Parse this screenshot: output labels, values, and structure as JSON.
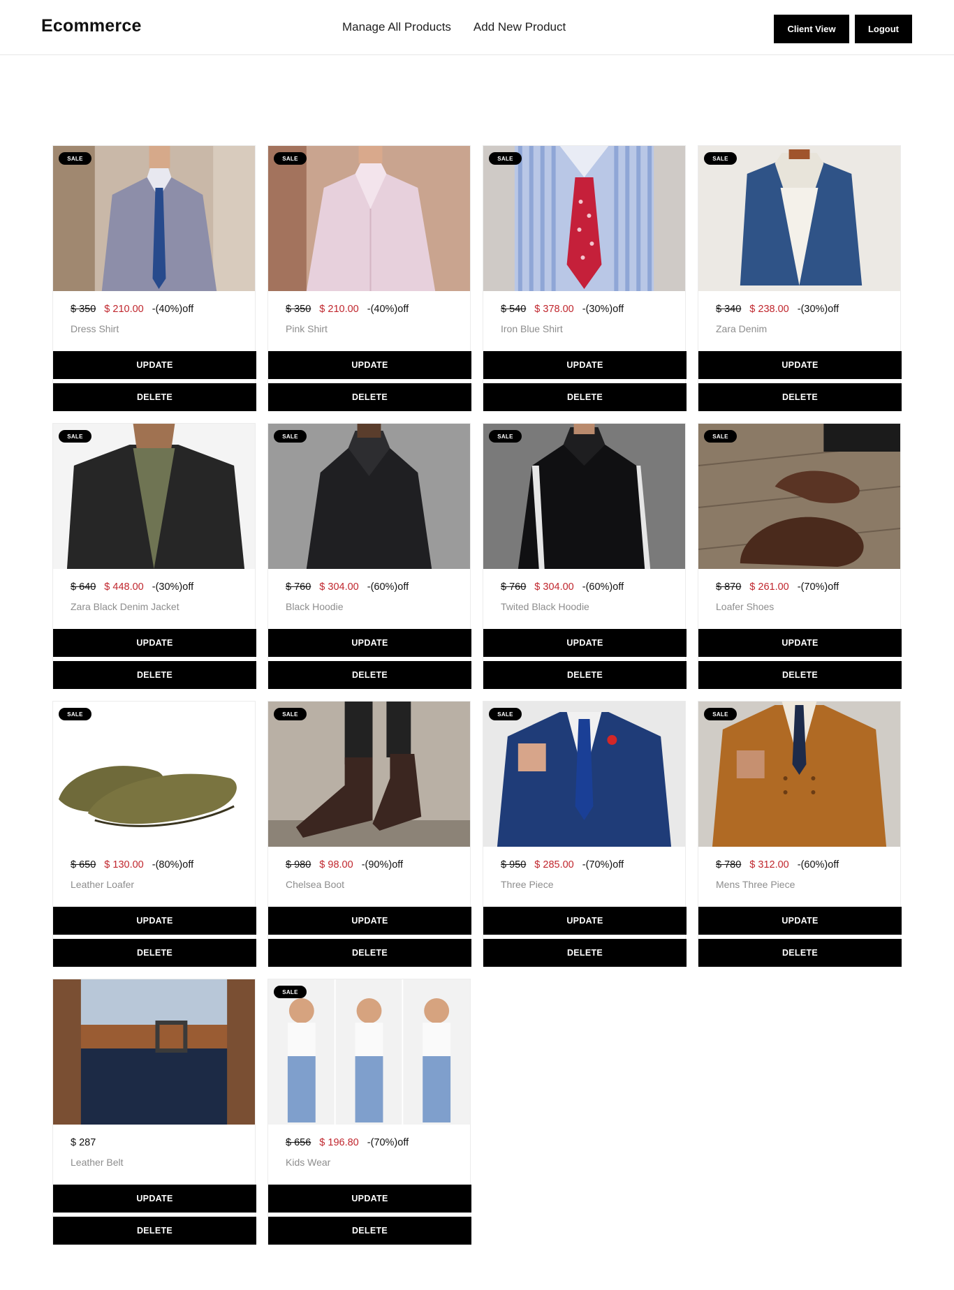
{
  "header": {
    "brand": "Ecommerce",
    "nav_links": [
      "Manage All Products",
      "Add New Product"
    ],
    "client_view_label": "Client View",
    "logout_label": "Logout"
  },
  "colors": {
    "accent": "#000000",
    "sale_price": "#c0262d",
    "muted_text": "#8d8d8d"
  },
  "labels": {
    "sale_badge": "SALE",
    "update": "UPDATE",
    "delete": "DELETE"
  },
  "products": [
    {
      "name": "Dress Shirt",
      "old_price": "$ 350",
      "new_price": "$ 210.00",
      "discount": "-(40%)off",
      "sale": true,
      "image": "shirt-purple-tie-photo"
    },
    {
      "name": "Pink Shirt",
      "old_price": "$ 350",
      "new_price": "$ 210.00",
      "discount": "-(40%)off",
      "sale": true,
      "image": "pink-shirt-photo"
    },
    {
      "name": "Iron Blue Shirt",
      "old_price": "$ 540",
      "new_price": "$ 378.00",
      "discount": "-(30%)off",
      "sale": true,
      "image": "striped-shirt-red-tie-photo"
    },
    {
      "name": "Zara Denim",
      "old_price": "$ 340",
      "new_price": "$ 238.00",
      "discount": "-(30%)off",
      "sale": true,
      "image": "denim-jacket-photo"
    },
    {
      "name": "Zara Black Denim Jacket",
      "old_price": "$ 640",
      "new_price": "$ 448.00",
      "discount": "-(30%)off",
      "sale": true,
      "image": "black-denim-jacket-photo"
    },
    {
      "name": "Black Hoodie",
      "old_price": "$ 760",
      "new_price": "$ 304.00",
      "discount": "-(60%)off",
      "sale": true,
      "image": "black-hoodie-photo"
    },
    {
      "name": "Twited Black Hoodie",
      "old_price": "$ 760",
      "new_price": "$ 304.00",
      "discount": "-(60%)off",
      "sale": true,
      "image": "black-hoodie-white-stripe-photo"
    },
    {
      "name": "Loafer Shoes",
      "old_price": "$ 870",
      "new_price": "$ 261.00",
      "discount": "-(70%)off",
      "sale": true,
      "image": "brown-loafer-photo"
    },
    {
      "name": "Leather Loafer",
      "old_price": "$ 650",
      "new_price": "$ 130.00",
      "discount": "-(80%)off",
      "sale": true,
      "image": "green-suede-loafer-photo"
    },
    {
      "name": "Chelsea Boot",
      "old_price": "$ 980",
      "new_price": "$ 98.00",
      "discount": "-(90%)off",
      "sale": true,
      "image": "chelsea-boot-photo"
    },
    {
      "name": "Three Piece",
      "old_price": "$ 950",
      "new_price": "$ 285.00",
      "discount": "-(70%)off",
      "sale": true,
      "image": "navy-suit-photo"
    },
    {
      "name": "Mens Three Piece",
      "old_price": "$ 780",
      "new_price": "$ 312.00",
      "discount": "-(60%)off",
      "sale": true,
      "image": "tan-suit-photo"
    },
    {
      "name": "Leather Belt",
      "price": "$ 287",
      "sale": false,
      "image": "leather-belt-photo"
    },
    {
      "name": "Kids Wear",
      "old_price": "$ 656",
      "new_price": "$ 196.80",
      "discount": "-(70%)off",
      "sale": true,
      "image": "kids-wear-photo"
    }
  ]
}
